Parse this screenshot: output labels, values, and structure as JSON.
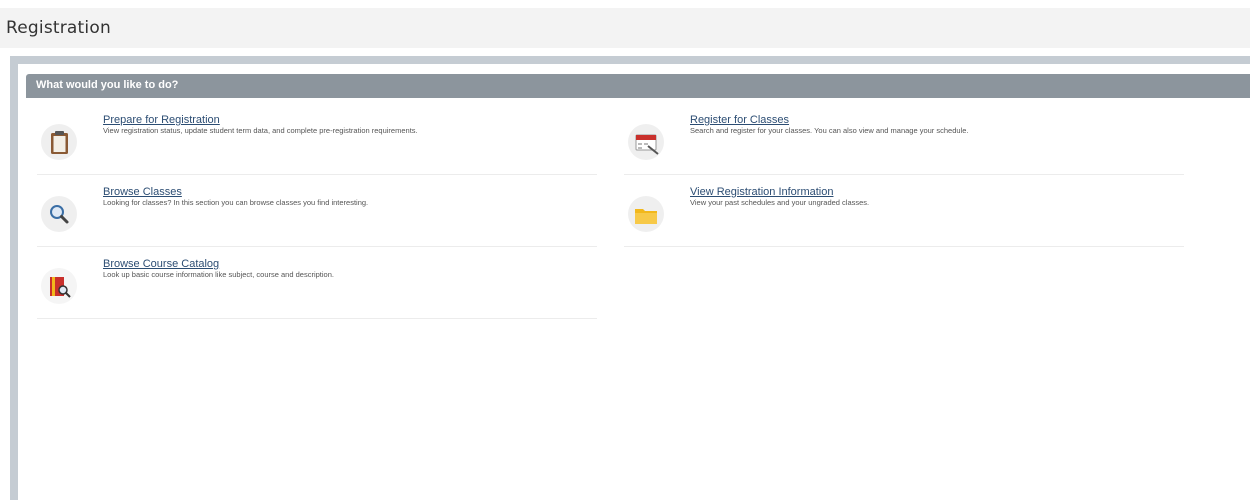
{
  "page": {
    "title": "Registration"
  },
  "panel": {
    "header": "What would you like to do?"
  },
  "actions": [
    {
      "title": "Prepare for Registration",
      "description": "View registration status, update student term data, and complete pre-registration requirements.",
      "icon": "clipboard-icon"
    },
    {
      "title": "Register for Classes",
      "description": "Search and register for your classes. You can also view and manage your schedule.",
      "icon": "calendar-icon"
    },
    {
      "title": "Browse Classes",
      "description": "Looking for classes? In this section you can browse classes you find interesting.",
      "icon": "magnifier-icon"
    },
    {
      "title": "View Registration Information",
      "description": "View your past schedules and your ungraded classes.",
      "icon": "folder-icon"
    },
    {
      "title": "Browse Course Catalog",
      "description": "Look up basic course information like subject, course and description.",
      "icon": "catalog-book-icon"
    }
  ]
}
